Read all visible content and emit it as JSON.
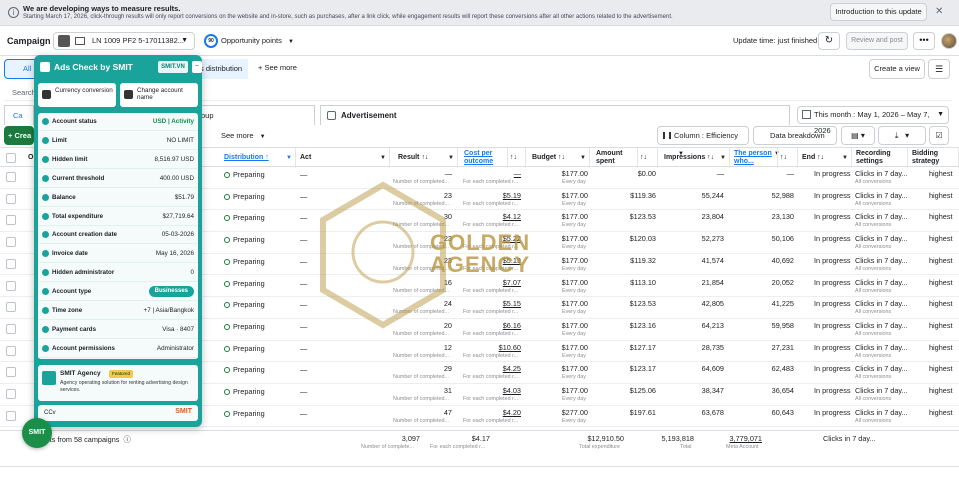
{
  "notice": {
    "title": "We are developing ways to measure results.",
    "body": "Starting March 17, 2026, click-through results will only report conversions on the website and in-store, such as purchases, after a link click, while engagement results will report these conversions after all other actions related to the advertisement.",
    "button": "Introduction to this update",
    "close": "✕"
  },
  "header": {
    "title": "Campaign",
    "account": "LN 1009 PF2 5-17011382...",
    "opportunity_score": "90",
    "opportunity_label": "Opportunity points",
    "update_time": "Update time: just finished",
    "review_button": "Review and post",
    "more": "•••"
  },
  "toolbar": {
    "all_label": "All",
    "distribution_tab": "s distribution",
    "see_more": "+  See more",
    "create_view": "Create a view"
  },
  "search": {
    "placeholder": "Search"
  },
  "tabs": {
    "campaign": "Ca",
    "group": "oup",
    "advertisement": "Advertisement",
    "date_range": "This month : May 1, 2026 – May 7, 2026"
  },
  "actions": {
    "create": "+ Crea",
    "see_more": "See more",
    "column": "Column : Efficiency",
    "data_breakdown": "Data breakdown"
  },
  "columns": [
    {
      "label": "O"
    },
    {
      "label": "Distribution ↑"
    },
    {
      "label": "Act"
    },
    {
      "label": "Result ↑↓"
    },
    {
      "label": "Cost per outcome"
    },
    {
      "label": "↑↓"
    },
    {
      "label": "Budget ↑↓"
    },
    {
      "label": "Amount spent"
    },
    {
      "label": "↑↓"
    },
    {
      "label": "Impressions ↑↓"
    },
    {
      "label": "The person who..."
    },
    {
      "label": "↑↓"
    },
    {
      "label": "End ↑↓"
    },
    {
      "label": "Recording settings"
    },
    {
      "label": "Bidding strategy"
    }
  ],
  "row_common": {
    "distribution": "Preparing",
    "act": "—",
    "result_sub": "Number of completed...",
    "cost_sub": "For each completed r...",
    "budget_sub": "Every day",
    "end": "In progress",
    "recording": "Clicks in 7 day...",
    "recording_sub": "All conversions",
    "bidding": "highest"
  },
  "rows": [
    {
      "result": "—",
      "cost": "—",
      "budget": "$177.00",
      "spent": "$0.00",
      "impressions": "—",
      "reach": "—"
    },
    {
      "result": "23",
      "cost": "$5.19",
      "budget": "$177.00",
      "spent": "$119.36",
      "impressions": "55,244",
      "reach": "52,988"
    },
    {
      "result": "30",
      "cost": "$4.12",
      "budget": "$177.00",
      "spent": "$123.53",
      "impressions": "23,804",
      "reach": "23,130"
    },
    {
      "result": "23",
      "cost": "$5.22",
      "budget": "$177.00",
      "spent": "$120.03",
      "impressions": "52,273",
      "reach": "50,106"
    },
    {
      "result": "23",
      "cost": "$5.19",
      "budget": "$177.00",
      "spent": "$119.32",
      "impressions": "41,574",
      "reach": "40,692"
    },
    {
      "result": "16",
      "cost": "$7.07",
      "budget": "$177.00",
      "spent": "$113.10",
      "impressions": "21,854",
      "reach": "20,052"
    },
    {
      "result": "24",
      "cost": "$5.15",
      "budget": "$177.00",
      "spent": "$123.53",
      "impressions": "42,805",
      "reach": "41,225"
    },
    {
      "result": "20",
      "cost": "$6.16",
      "budget": "$177.00",
      "spent": "$123.16",
      "impressions": "64,213",
      "reach": "59,958"
    },
    {
      "result": "12",
      "cost": "$10.60",
      "budget": "$177.00",
      "spent": "$127.17",
      "impressions": "28,735",
      "reach": "27,231"
    },
    {
      "result": "29",
      "cost": "$4.25",
      "budget": "$177.00",
      "spent": "$123.17",
      "impressions": "64,609",
      "reach": "62,483"
    },
    {
      "result": "31",
      "cost": "$4.03",
      "budget": "$177.00",
      "spent": "$125.06",
      "impressions": "38,347",
      "reach": "36,654"
    },
    {
      "result": "47",
      "cost": "$4.20",
      "budget": "$277.00",
      "spent": "$197.61",
      "impressions": "63,678",
      "reach": "60,643"
    }
  ],
  "totals": {
    "label": "ults from 58 campaigns",
    "result": "3,097",
    "result_sub": "Number of complete...",
    "cost": "$4.17",
    "cost_sub": "For each completed r...",
    "spent": "$12,910.50",
    "spent_sub": "Total expenditure",
    "impressions": "5,193,818",
    "impressions_sub": "Total",
    "reach": "3,779,071",
    "reach_sub": "Meta Account",
    "recording": "Clicks in 7 day..."
  },
  "watermark": {
    "line1": "GOLDEN",
    "line2": "AGENCY"
  },
  "panel": {
    "title": "Ads Check by SMIT",
    "badge": "SMIT.VN",
    "minimize": "–",
    "quick1": "Currency conversion",
    "quick2": "Change account name",
    "info": [
      {
        "key": "Account status",
        "value": "USD | Activity"
      },
      {
        "key": "Limit",
        "value": "NO LIMIT"
      },
      {
        "key": "Hidden limit",
        "value": "8,516.97 USD"
      },
      {
        "key": "Current threshold",
        "value": "400.00 USD"
      },
      {
        "key": "Balance",
        "value": "$51.79"
      },
      {
        "key": "Total expenditure",
        "value": "$27,719.64"
      },
      {
        "key": "Account creation date",
        "value": "05-03-2026"
      },
      {
        "key": "Invoice date",
        "value": "May 16, 2026"
      },
      {
        "key": "Hidden administrator",
        "value": "0"
      },
      {
        "key": "Account type",
        "value": "Businesses"
      },
      {
        "key": "Time zone",
        "value": "+7 | Asia/Bangkok"
      },
      {
        "key": "Payment cards",
        "value": "Visa · 8407"
      },
      {
        "key": "Account permissions",
        "value": "Administrator"
      }
    ],
    "agency_name": "SMIT Agency",
    "agency_tag": "Featured",
    "agency_desc": "Agency operating solution for renting advertising design services.",
    "footer_left": "CCv",
    "footer_right": "SMIT"
  },
  "fab": "SMIT"
}
